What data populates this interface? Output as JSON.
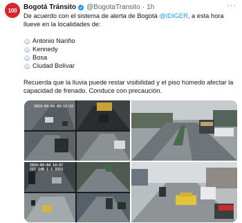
{
  "tweet": {
    "avatar_text": "100",
    "author_name": "Bogotá Tránsito",
    "author_handle": "@BogotaTransito",
    "separator": "·",
    "time": "1h",
    "intro_before": "De acuerdo con el sistema de alerta de Bogotá ",
    "intro_mention": "@IDIGER",
    "intro_after": ", a esta hora llueve en la localidades de:",
    "localities": [
      "Antonio Nariño",
      "Kennedy",
      "Bosa",
      "Ciudad Bolívar"
    ],
    "advice": "Recuerda que la lluvia puede restar visibilidad y el piso húmedo afectar la capacidad de frenado. Conduce con precaución.",
    "colors": {
      "brand": "#d7262e",
      "verified": "#1d9bf0",
      "mention": "#1d9bf0",
      "text": "#0f1419",
      "muted": "#536471"
    }
  },
  "media": [
    {
      "stamp": "2024-04-04 09:52:12"
    },
    {
      "stamp": ""
    },
    {
      "stamp": "2024-04-04 14:47",
      "caption": "CGT 14B 1 1 3353"
    },
    {
      "stamp": ""
    }
  ]
}
